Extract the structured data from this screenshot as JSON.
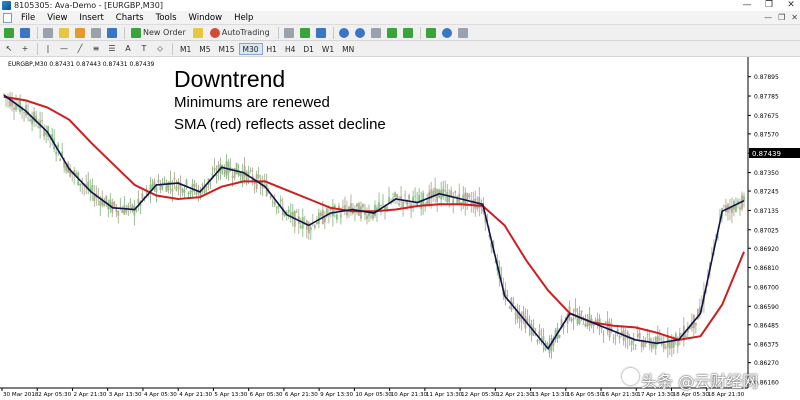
{
  "window": {
    "title": "8105305: Ava-Demo - [EURGBP,M30]",
    "controls": [
      "—",
      "❐",
      "✕"
    ]
  },
  "menu": {
    "items": [
      "File",
      "View",
      "Insert",
      "Charts",
      "Tools",
      "Window",
      "Help"
    ],
    "right_controls": [
      "—",
      "❐",
      "✕"
    ]
  },
  "toolbar": {
    "new_order_label": "New Order",
    "autotrading_label": "AutoTrading",
    "timeframes": [
      "M1",
      "M5",
      "M15",
      "M30",
      "H1",
      "H4",
      "D1",
      "W1",
      "MN"
    ],
    "active_timeframe": "M30",
    "text_tool_label": "A",
    "label_tool_label": "T"
  },
  "chart": {
    "symbol_label": "EURGBP,M30  0.87431 0.87443 0.87431 0.87439",
    "current_price": "0.87439",
    "annotation": {
      "title": "Downtrend",
      "line1": "Minimums are  renewed",
      "line2": "SMA (red) reflects asset decline"
    },
    "price_labels": [
      "0.87895",
      "0.87785",
      "0.87675",
      "0.87570",
      "0.87460",
      "0.87350",
      "0.87245",
      "0.87135",
      "0.87025",
      "0.86920",
      "0.86810",
      "0.86700",
      "0.86590",
      "0.86485",
      "0.86375",
      "0.86270",
      "0.86160"
    ],
    "time_labels": [
      "30 Mar 2018",
      "2 Apr 05:30",
      "2 Apr 21:30",
      "3 Apr 13:30",
      "4 Apr 05:30",
      "4 Apr 21:30",
      "5 Apr 13:30",
      "6 Apr 05:30",
      "6 Apr 21:30",
      "9 Apr 13:30",
      "10 Apr 05:30",
      "10 Apr 21:30",
      "11 Apr 13:30",
      "12 Apr 05:30",
      "12 Apr 21:30",
      "13 Apr 13:30",
      "16 Apr 05:30",
      "16 Apr 21:30",
      "17 Apr 13:30",
      "18 Apr 05:30",
      "18 Apr 21:30"
    ],
    "colors": {
      "candles": "#8fa88a",
      "fast_line": "#10124a",
      "sma": "#cc1f1f",
      "background": "#ffffff",
      "axis": "#000000",
      "price_tag": "#000000"
    }
  },
  "chart_data": {
    "type": "line",
    "series": [
      {
        "name": "SMA (red)",
        "values": [
          0.8778,
          0.8776,
          0.8772,
          0.8765,
          0.8752,
          0.874,
          0.8728,
          0.8722,
          0.872,
          0.8721,
          0.8727,
          0.873,
          0.873,
          0.8725,
          0.872,
          0.8715,
          0.8713,
          0.8713,
          0.8714,
          0.8716,
          0.8717,
          0.8717,
          0.8716,
          0.8705,
          0.8685,
          0.8668,
          0.8655,
          0.865,
          0.8648,
          0.8647,
          0.8644,
          0.864,
          0.8642,
          0.866,
          0.869
        ]
      },
      {
        "values": [
          0.8779,
          0.877,
          0.8758,
          0.8737,
          0.8724,
          0.8715,
          0.8714,
          0.8728,
          0.8729,
          0.8724,
          0.8738,
          0.8735,
          0.8727,
          0.8711,
          0.8705,
          0.8712,
          0.8714,
          0.8712,
          0.872,
          0.8718,
          0.8723,
          0.872,
          0.8717,
          0.8665,
          0.865,
          0.8635,
          0.8655,
          0.865,
          0.8645,
          0.864,
          0.8638,
          0.864,
          0.8655,
          0.8713,
          0.8719
        ]
      }
    ],
    "ylim": [
      0.8616,
      0.8795
    ]
  },
  "watermark": {
    "text": "头条 @云财经网"
  }
}
